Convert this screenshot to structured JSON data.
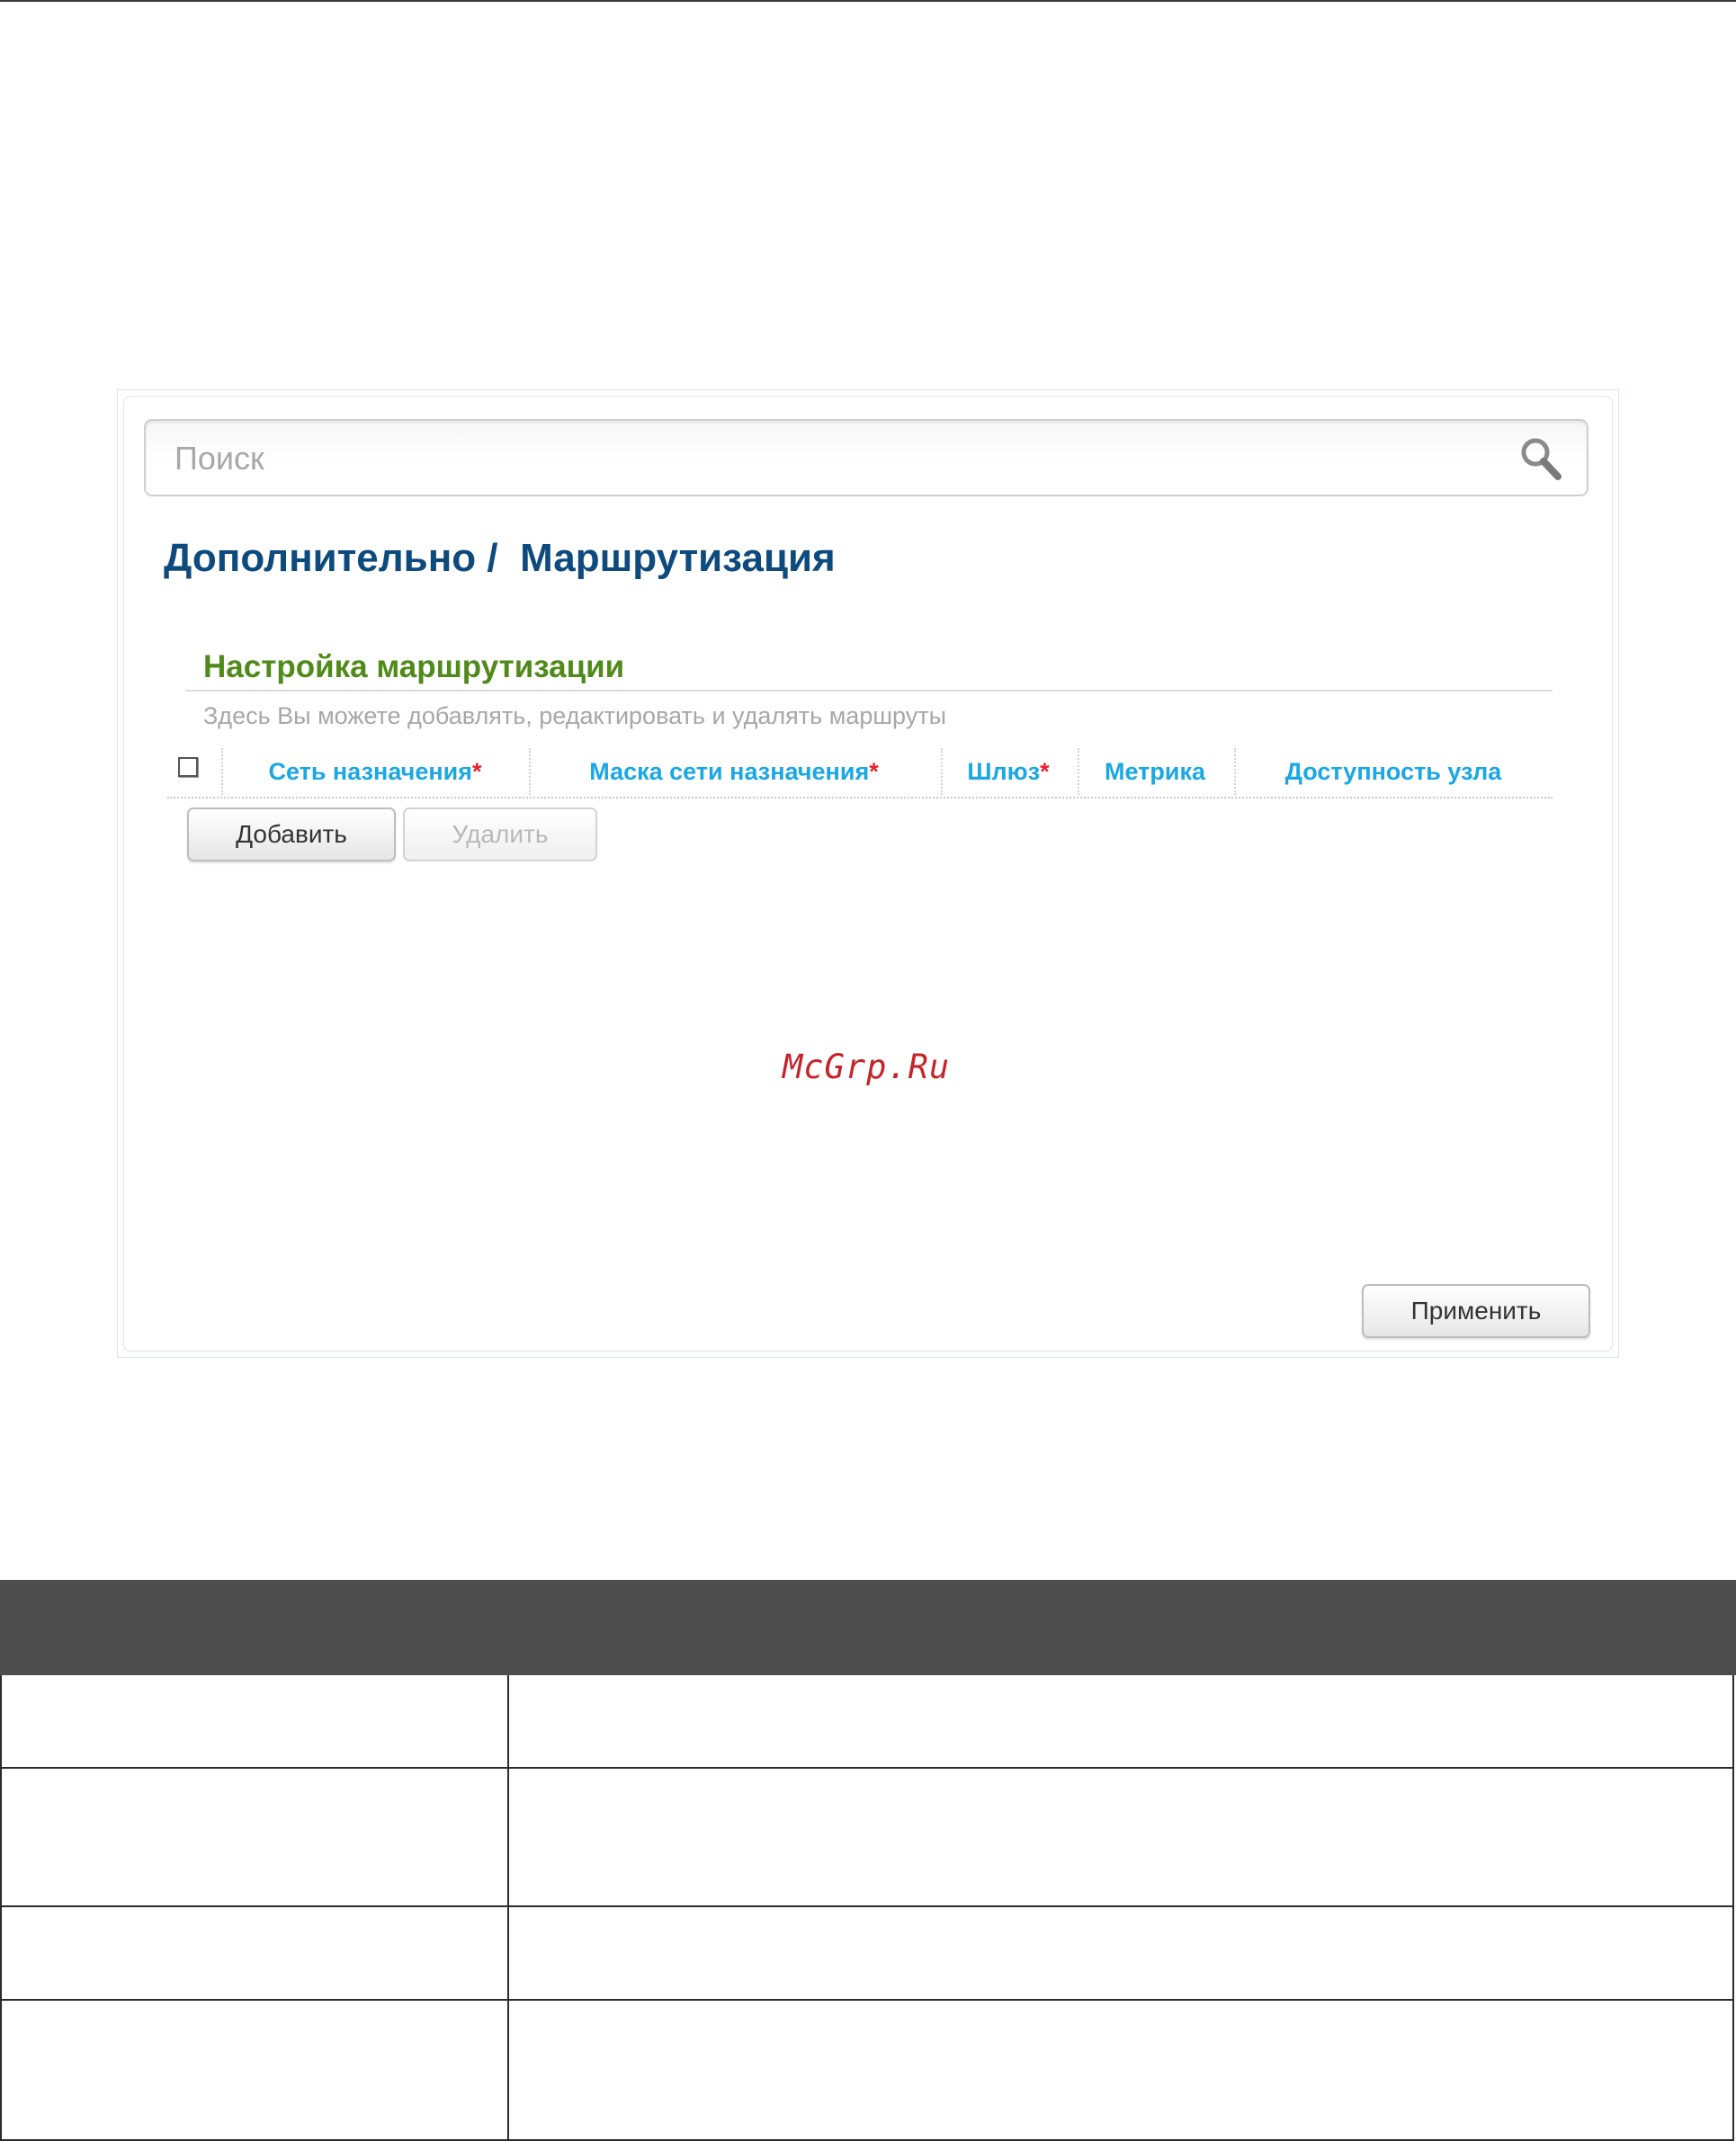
{
  "search": {
    "placeholder": "Поиск"
  },
  "breadcrumb": "Дополнительно /  Маршрутизация",
  "section": {
    "title": "Настройка маршрутизации",
    "description": "Здесь Вы можете добавлять, редактировать и удалять маршруты"
  },
  "table": {
    "columns": [
      {
        "label": "Сеть назначения",
        "required": "*"
      },
      {
        "label": "Маска сети назначения",
        "required": "*"
      },
      {
        "label": "Шлюз",
        "required": "*"
      },
      {
        "label": "Метрика",
        "required": ""
      },
      {
        "label": "Доступность узла",
        "required": ""
      }
    ]
  },
  "buttons": {
    "add": "Добавить",
    "delete": "Удалить",
    "apply": "Применить"
  },
  "watermark": "McGrp.Ru",
  "colors": {
    "title": "#0d4a7e",
    "section_title": "#4f8a1a",
    "column_header": "#1aa7e4",
    "required_mark": "#e8212e",
    "table_header_bg": "#4d4d4d"
  }
}
